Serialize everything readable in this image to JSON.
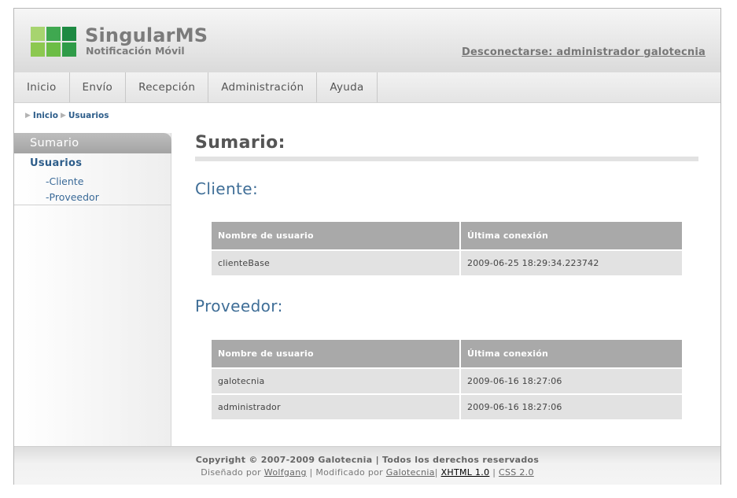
{
  "header": {
    "title": "SingularMS",
    "subtitle": "Notificación Móvil",
    "logout_link": "Desconectarse: administrador galotecnia"
  },
  "nav": {
    "items": [
      {
        "label": "Inicio"
      },
      {
        "label": "Envío"
      },
      {
        "label": "Recepción"
      },
      {
        "label": "Administración"
      },
      {
        "label": "Ayuda"
      }
    ]
  },
  "breadcrumb": {
    "items": [
      "Inicio",
      "Usuarios"
    ]
  },
  "sidebar": {
    "heading": "Sumario",
    "section": "Usuarios",
    "links": [
      "-Cliente",
      "-Proveedor"
    ]
  },
  "main": {
    "title": "Sumario:",
    "cliente": {
      "title": "Cliente:",
      "columns": [
        "Nombre de usuario",
        "Última conexión"
      ],
      "rows": [
        [
          "clienteBase",
          "2009-06-25 18:29:34.223742"
        ]
      ]
    },
    "proveedor": {
      "title": "Proveedor:",
      "columns": [
        "Nombre de usuario",
        "Última conexión"
      ],
      "rows": [
        [
          "galotecnia",
          "2009-06-16 18:27:06"
        ],
        [
          "administrador",
          "2009-06-16 18:27:06"
        ]
      ]
    }
  },
  "footer": {
    "copyright": "Copyright © 2007-2009 Galotecnia | Todos los derechos reservados",
    "designed_by": "Diseñado por",
    "designer": "Wolfgang",
    "sep1": " | Modificado por ",
    "modifier": "Galotecnia",
    "sep2": "| ",
    "xhtml": "XHTML 1.0",
    "sep3": " | ",
    "css": "CSS 2.0"
  },
  "colors": {
    "link": "#2d5d8a",
    "section": "#3f6e97",
    "table_header": "#a9a9a9",
    "table_cell": "#e2e2e2"
  }
}
